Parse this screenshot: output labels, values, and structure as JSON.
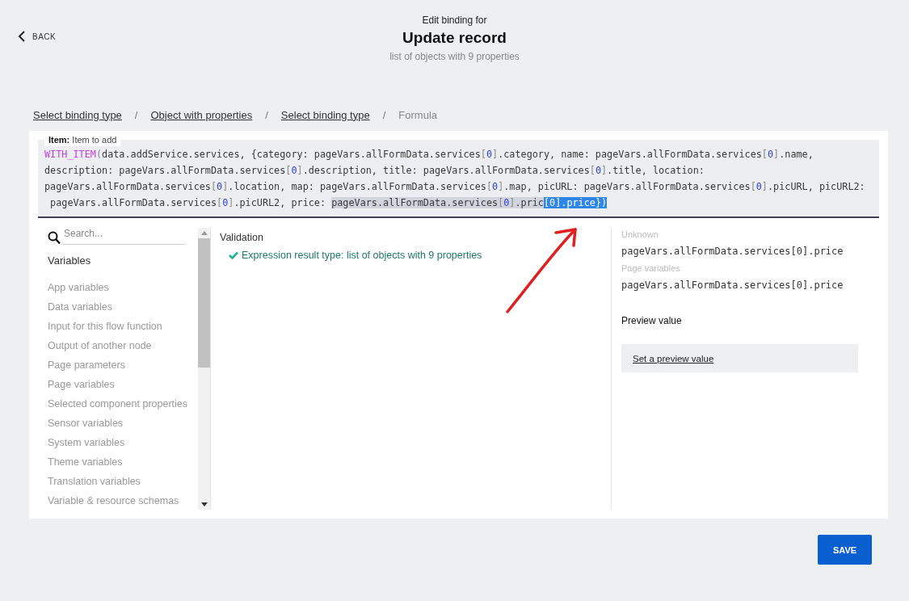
{
  "header": {
    "back": "BACK",
    "subtitle": "Edit binding for",
    "title": "Update record",
    "description": "list of objects with 9 properties"
  },
  "breadcrumbs": [
    {
      "label": "Select binding type",
      "link": true
    },
    {
      "label": "Object with properties",
      "link": true
    },
    {
      "label": "Select binding type",
      "link": true
    },
    {
      "label": "Formula",
      "link": false
    }
  ],
  "breadcrumb_separator": "/",
  "editor": {
    "label": "Item:",
    "label_text": "Item to add",
    "lines": [
      [
        {
          "text": "WITH_ITEM",
          "kind": "function"
        },
        {
          "text": "(",
          "kind": "punct"
        },
        {
          "text": "data.addService.services, {category: pageVars.allFormData.services",
          "kind": "code"
        },
        {
          "text": "[",
          "kind": "punct"
        },
        {
          "text": "0",
          "kind": "index"
        },
        {
          "text": "]",
          "kind": "punct"
        },
        {
          "text": ".category, name: pageVars.allFormData.services",
          "kind": "code"
        },
        {
          "text": "[",
          "kind": "punct"
        },
        {
          "text": "0",
          "kind": "index"
        },
        {
          "text": "]",
          "kind": "punct"
        },
        {
          "text": ".name,",
          "kind": "code"
        }
      ],
      [
        {
          "text": "description: pageVars.allFormData.services",
          "kind": "code"
        },
        {
          "text": "[",
          "kind": "punct"
        },
        {
          "text": "0",
          "kind": "index"
        },
        {
          "text": "]",
          "kind": "punct"
        },
        {
          "text": ".description, title: pageVars.allFormData.services",
          "kind": "code"
        },
        {
          "text": "[",
          "kind": "punct"
        },
        {
          "text": "0",
          "kind": "index"
        },
        {
          "text": "]",
          "kind": "punct"
        },
        {
          "text": ".title, location:",
          "kind": "code"
        }
      ],
      [
        {
          "text": "pageVars.allFormData.services",
          "kind": "code"
        },
        {
          "text": "[",
          "kind": "punct"
        },
        {
          "text": "0",
          "kind": "index"
        },
        {
          "text": "]",
          "kind": "punct"
        },
        {
          "text": ".location, map: pageVars.allFormData.services",
          "kind": "code"
        },
        {
          "text": "[",
          "kind": "punct"
        },
        {
          "text": "0",
          "kind": "index"
        },
        {
          "text": "]",
          "kind": "punct"
        },
        {
          "text": ".map, picURL: pageVars.allFormData.services",
          "kind": "code"
        },
        {
          "text": "[",
          "kind": "punct"
        },
        {
          "text": "0",
          "kind": "index"
        },
        {
          "text": "]",
          "kind": "punct"
        },
        {
          "text": ".picURL, picURL2:",
          "kind": "code"
        }
      ],
      [
        {
          "text": " pageVars.allFormData.services",
          "kind": "code"
        },
        {
          "text": "[",
          "kind": "punct"
        },
        {
          "text": "0",
          "kind": "index"
        },
        {
          "text": "]",
          "kind": "punct"
        },
        {
          "text": ".picURL2, price: ",
          "kind": "code"
        },
        {
          "text": "pageVars.allFormData.services",
          "kind": "match-code"
        },
        {
          "text": "[",
          "kind": "match-punct"
        },
        {
          "text": "0",
          "kind": "match-index"
        },
        {
          "text": "]",
          "kind": "match-punct"
        },
        {
          "text": ".pric",
          "kind": "match-code"
        },
        {
          "text": "[0].price})",
          "kind": "selection"
        }
      ]
    ]
  },
  "sidebar": {
    "search": {
      "placeholder": "Search..."
    },
    "heading": "Variables",
    "items": [
      "App variables",
      "Data variables",
      "Input for this flow function",
      "Output of another node",
      "Page parameters",
      "Page variables",
      "Selected component properties",
      "Sensor variables",
      "System variables",
      "Theme variables",
      "Translation variables",
      "Variable & resource schemas"
    ]
  },
  "validation": {
    "heading": "Validation",
    "message": "Expression result type: list of objects with 9 properties"
  },
  "details": {
    "groups": [
      {
        "heading": "Unknown",
        "value": "pageVars.allFormData.services[0].price"
      },
      {
        "heading": "Page variables",
        "value": "pageVars.allFormData.services[0].price"
      }
    ],
    "preview_heading": "Preview value",
    "preview_link": "Set a preview value"
  },
  "save_button": "SAVE"
}
